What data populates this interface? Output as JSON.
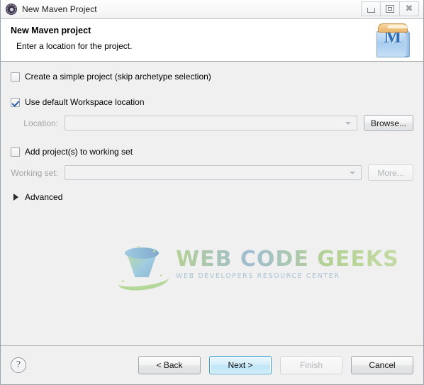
{
  "window": {
    "title": "New Maven Project",
    "app_icon": "eclipse-wizard-icon",
    "controls": {
      "minimize": "minimize-icon",
      "maximize": "maximize-icon",
      "close": "close-icon"
    }
  },
  "header": {
    "title": "New Maven project",
    "subtitle": "Enter a location for the project.",
    "icon_letter": "M",
    "icon_name": "maven-project-icon"
  },
  "form": {
    "simple_project": {
      "label": "Create a simple project (skip archetype selection)",
      "checked": false
    },
    "default_workspace": {
      "label": "Use default Workspace location",
      "checked": true
    },
    "location": {
      "label": "Location:",
      "value": "",
      "placeholder": "",
      "disabled": true,
      "browse_label": "Browse..."
    },
    "working_set_checkbox": {
      "label": "Add project(s) to working set",
      "checked": false
    },
    "working_set": {
      "label": "Working set:",
      "value": "",
      "placeholder": "",
      "disabled": true,
      "more_label": "More..."
    },
    "advanced": {
      "label": "Advanced",
      "expanded": false
    }
  },
  "watermark": {
    "main": "WEB CODE GEEKS",
    "sub": "WEB DEVELOPERS RESOURCE CENTER"
  },
  "footer": {
    "help": "?",
    "back": "< Back",
    "next": "Next >",
    "finish": "Finish",
    "cancel": "Cancel"
  },
  "colors": {
    "accent": "#3c9fd4",
    "dialog_bg": "#f0f0f0",
    "header_bg": "#ffffff",
    "disabled_text": "#b0b4b8",
    "maven_blue": "#2f6fb5",
    "watermark_green": "#8fbe5e"
  }
}
